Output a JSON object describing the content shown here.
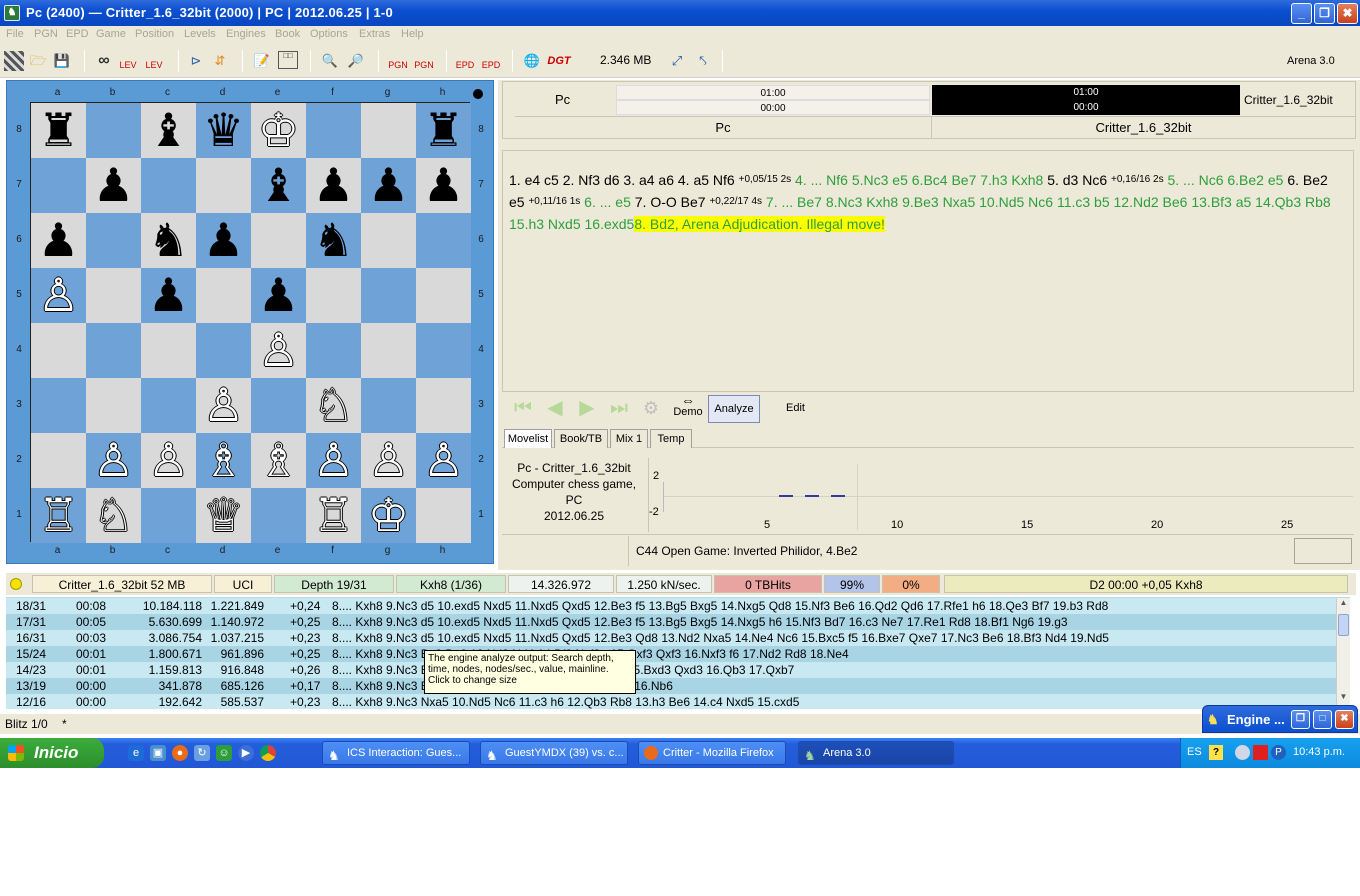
{
  "window": {
    "title": "Pc (2400)  —  Critter_1.6_32bit (2000)   |   PC   |   2012.06.25   |   1-0",
    "minimize": "_",
    "maximize": "❐",
    "close": "✖"
  },
  "menu": [
    "File",
    "PGN",
    "EPD",
    "Game",
    "Position",
    "Levels",
    "Engines",
    "Book",
    "Options",
    "Extras",
    "Help"
  ],
  "toolbar": {
    "lev_label": "LEV",
    "pgn_label": "PGN",
    "epd_label": "EPD",
    "dgt_label": "DGT",
    "memory": "2.346 MB",
    "app_name": "Arena 3.0"
  },
  "board": {
    "files": [
      "a",
      "b",
      "c",
      "d",
      "e",
      "f",
      "g",
      "h"
    ],
    "ranks": [
      "8",
      "7",
      "6",
      "5",
      "4",
      "3",
      "2",
      "1"
    ],
    "pieces": [
      {
        "sq": "a8",
        "glyph": "♜",
        "color": "b"
      },
      {
        "sq": "c8",
        "glyph": "♝",
        "color": "b"
      },
      {
        "sq": "d8",
        "glyph": "♛",
        "color": "b"
      },
      {
        "sq": "e8",
        "glyph": "♔",
        "color": "w"
      },
      {
        "sq": "h8",
        "glyph": "♜",
        "color": "b"
      },
      {
        "sq": "b7",
        "glyph": "♟",
        "color": "b"
      },
      {
        "sq": "e7",
        "glyph": "♝",
        "color": "b"
      },
      {
        "sq": "f7",
        "glyph": "♟",
        "color": "b"
      },
      {
        "sq": "g7",
        "glyph": "♟",
        "color": "b"
      },
      {
        "sq": "h7",
        "glyph": "♟",
        "color": "b"
      },
      {
        "sq": "a6",
        "glyph": "♟",
        "color": "b"
      },
      {
        "sq": "c6",
        "glyph": "♞",
        "color": "b"
      },
      {
        "sq": "d6",
        "glyph": "♟",
        "color": "b"
      },
      {
        "sq": "f6",
        "glyph": "♞",
        "color": "b"
      },
      {
        "sq": "a5",
        "glyph": "♙",
        "color": "w"
      },
      {
        "sq": "c5",
        "glyph": "♟",
        "color": "b"
      },
      {
        "sq": "e5",
        "glyph": "♟",
        "color": "b"
      },
      {
        "sq": "e4",
        "glyph": "♙",
        "color": "w"
      },
      {
        "sq": "d3",
        "glyph": "♙",
        "color": "w"
      },
      {
        "sq": "f3",
        "glyph": "♘",
        "color": "w"
      },
      {
        "sq": "b2",
        "glyph": "♙",
        "color": "w"
      },
      {
        "sq": "c2",
        "glyph": "♙",
        "color": "w"
      },
      {
        "sq": "d2",
        "glyph": "♗",
        "color": "w"
      },
      {
        "sq": "e2",
        "glyph": "♗",
        "color": "w"
      },
      {
        "sq": "f2",
        "glyph": "♙",
        "color": "w"
      },
      {
        "sq": "g2",
        "glyph": "♙",
        "color": "w"
      },
      {
        "sq": "h2",
        "glyph": "♙",
        "color": "w"
      },
      {
        "sq": "a1",
        "glyph": "♖",
        "color": "w"
      },
      {
        "sq": "b1",
        "glyph": "♘",
        "color": "w"
      },
      {
        "sq": "d1",
        "glyph": "♕",
        "color": "w"
      },
      {
        "sq": "f1",
        "glyph": "♖",
        "color": "w"
      },
      {
        "sq": "g1",
        "glyph": "♔",
        "color": "w"
      }
    ]
  },
  "clock": {
    "white_name": "Pc",
    "black_name": "Critter_1.6_32bit",
    "white_time": "01:00",
    "white_sub": "00:00",
    "black_time": "01:00",
    "black_sub": "00:00",
    "white_label": "Pc",
    "black_label": "Critter_1.6_32bit"
  },
  "notation": {
    "p1": "1. e4 c5 2. Nf3 d6 3. a4 a6 4. a5 Nf6",
    "a1": "+0,05/15 2s",
    "g1": "4. ... Nf6 5.Nc3 e5 6.Bc4 Be7 7.h3 Kxh8",
    "p2": "5. d3 Nc6",
    "a2": "+0,16/16 2s",
    "g2": "5. ... Nc6 6.Be2 e5",
    "p3": "6. Be2 e5",
    "a3": "+0,11/16 1s",
    "g3": "6. ... e5",
    "p4": "7. O-O Be7",
    "a4": "+0,22/17 4s",
    "g4": "7. ... Be7 8.Nc3 Kxh8 9.Be3 Nxa5 10.Nd5 Nc6 11.c3 b5 12.Nd2 Be6 13.Bf3 a5 14.Qb3 Rb8 15.h3 Nxd5 16.exd5",
    "final": "8. Bd2, ",
    "final_note": "Arena Adjudication. Illegal move!"
  },
  "nav": {
    "first": "⏮",
    "back": "◀",
    "forward": "▶",
    "last": "⏭",
    "demo": "Demo",
    "analyze": "Analyze",
    "edit": "Edit"
  },
  "tabs": [
    "Movelist",
    "Book/TB",
    "Mix 1",
    "Temp"
  ],
  "gameinfo": {
    "line1": "Pc - Critter_1.6_32bit",
    "line2": "Computer chess game,",
    "line3": "PC",
    "line4": "2012.06.25"
  },
  "graph": {
    "y_top": "2",
    "y_bottom": "-2",
    "x_ticks": [
      "5",
      "10",
      "15",
      "20",
      "25"
    ]
  },
  "opening": "C44  Open Game: Inverted Philidor, 4.Be2",
  "engine_status": {
    "name": "Critter_1.6_32bit  52 MB",
    "protocol": "UCI",
    "depth": "Depth 19/31",
    "move": "Kxh8 (1/36)",
    "nodes": "14.326.972",
    "speed": "1.250 kN/sec.",
    "tbhits": "0 TBHits",
    "hash": "99%",
    "cpu": "0%",
    "best": "D2  00:00  +0,05    Kxh8"
  },
  "analysis": [
    {
      "depth": "18/31",
      "time": "00:08",
      "nodes": "10.184.118",
      "nps": "1.221.849",
      "value": "+0,24",
      "line": "8.... Kxh8 9.Nc3 d5 10.exd5 Nxd5 11.Nxd5 Qxd5 12.Be3 f5 13.Bg5 Bxg5 14.Nxg5 Qd8 15.Nf3 Be6 16.Qd2 Qd6 17.Rfe1 h6 18.Qe3 Bf7 19.b3 Rd8"
    },
    {
      "depth": "17/31",
      "time": "00:05",
      "nodes": "5.630.699",
      "nps": "1.140.972",
      "value": "+0,25",
      "line": "8.... Kxh8 9.Nc3 d5 10.exd5 Nxd5 11.Nxd5 Qxd5 12.Be3 f5 13.Bg5 Bxg5 14.Nxg5 h6 15.Nf3 Bd7 16.c3 Ne7 17.Re1 Rd8 18.Bf1 Ng6 19.g3"
    },
    {
      "depth": "16/31",
      "time": "00:03",
      "nodes": "3.086.754",
      "nps": "1.037.215",
      "value": "+0,23",
      "line": "8.... Kxh8 9.Nc3 d5 10.exd5 Nxd5 11.Nxd5 Qxd5 12.Be3 Qd8 13.Nd2 Nxa5 14.Ne4 Nc6 15.Bxc5 f5 16.Bxe7 Qxe7 17.Nc3 Be6 18.Bf3 Nd4 19.Nd5"
    },
    {
      "depth": "15/24",
      "time": "00:01",
      "nodes": "1.800.671",
      "nps": "961.896",
      "value": "+0,25",
      "line": "8.... Kxh8 9.Nc3                                        Be3 Be6 13.Nd2 Nd4 14.Bf3 Nxf3+ 15.Qxf3 Qxf3 16.Nxf3 f6 17.Nd2 Rd8 18.Ne4"
    },
    {
      "depth": "14/23",
      "time": "00:01",
      "nodes": "1.159.813",
      "nps": "916.848",
      "value": "+0,26",
      "line": "8.... Kxh8 9.Nc3                                        Bg5 f6 13.Be3 13.c3 Bf5 14.Nd2 Bxd3 15.Bxd3 Qxd3 16.Qb3 17.Qxb7"
    },
    {
      "depth": "13/19",
      "time": "00:00",
      "nodes": "341.878",
      "nps": "685.126",
      "value": "+0,17",
      "line": "8.... Kxh8 9.Nc3                                        Be6 13.c4 h6 14.Qb3 Rb8 15.Rfe1 Qd7 16.Nb6"
    },
    {
      "depth": "12/16",
      "time": "00:00",
      "nodes": "192.642",
      "nps": "585.537",
      "value": "+0,23",
      "line": "8.... Kxh8 9.Nc3 Nxa5 10.Nd5 Nc6 11.c3 h6 12.Qb3 Rb8 13.h3 Be6 14.c4 Nxd5 15.cxd5"
    }
  ],
  "tooltip": "The engine analyze output: Search depth, time, nodes, nodes/sec., value, mainline. Click to change size",
  "status": {
    "mode": "Blitz 1/0",
    "marker": "*"
  },
  "engine_window": {
    "title": "Engine ..."
  },
  "taskbar": {
    "start": "Inicio",
    "tasks": [
      "ICS Interaction: Gues...",
      "GuestYMDX (39) vs. c...",
      "Critter - Mozilla Firefox",
      "Arena 3.0"
    ],
    "lang": "ES",
    "clock": "10:43 p.m."
  }
}
